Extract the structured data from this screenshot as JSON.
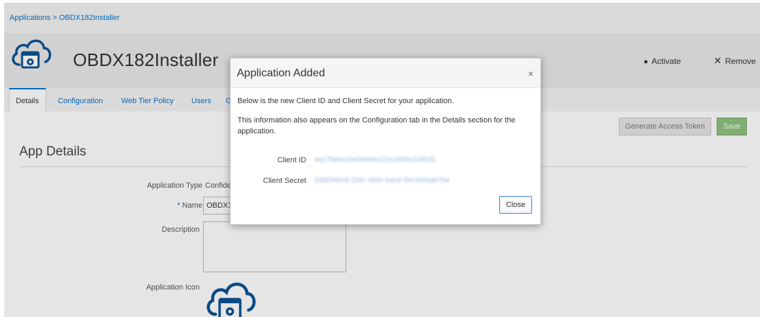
{
  "breadcrumb": {
    "text": "Applications > OBDX182Installer"
  },
  "header": {
    "title": "OBDX182Installer",
    "actions": {
      "activate": "Activate",
      "remove": "Remove"
    },
    "icon": "cloud-app-icon"
  },
  "tabs": [
    {
      "label": "Details",
      "active": true
    },
    {
      "label": "Configuration"
    },
    {
      "label": "Web Tier Policy"
    },
    {
      "label": "Users"
    },
    {
      "label": "G"
    }
  ],
  "toolbar": {
    "generate_label": "Generate Access Token",
    "save_label": "Save"
  },
  "details": {
    "section_title": "App Details",
    "application_type_label": "Application Type",
    "application_type_value": "Confide",
    "required_mark": "*",
    "name_label": "Name",
    "name_value": "OBDX1",
    "description_label": "Description",
    "application_icon_label": "Application Icon"
  },
  "dialog": {
    "title": "Application Added",
    "close_symbol": "×",
    "line1": "Below is the new Client ID and Client Secret for your application.",
    "line2": "This information also appears on the Configuration tab in the Details section for the application.",
    "client_id_label": "Client ID",
    "client_id_value": "aa17bebcc5a0448dcc21e1b55c22db29",
    "client_secret_label": "Client Secret",
    "client_secret_value": "0382060c8-226c-456e-baed-5be3e0eab7ba",
    "close_button": "Close"
  },
  "colors": {
    "link": "#0572ce",
    "save": "#8fc17e",
    "header_bg": "#e9e9e9"
  }
}
